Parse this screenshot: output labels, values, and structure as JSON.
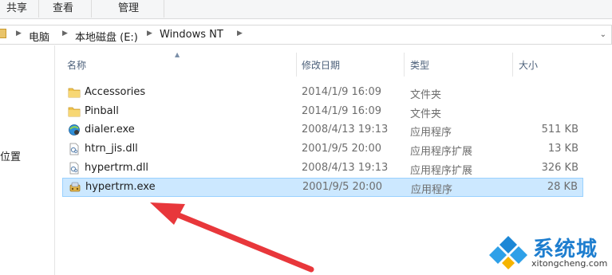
{
  "ribbon": {
    "tabs": [
      {
        "label": "共享"
      },
      {
        "label": "查看"
      },
      {
        "label": "管理"
      }
    ]
  },
  "address": {
    "crumbs": [
      "电脑",
      "本地磁盘 (E:)",
      "Windows NT"
    ]
  },
  "nav": {
    "partial_item": "位置"
  },
  "columns": {
    "name": "名称",
    "date": "修改日期",
    "type": "类型",
    "size": "大小"
  },
  "files": [
    {
      "name": "Accessories",
      "date": "2014/1/9 16:09",
      "type": "文件夹",
      "size": "",
      "icon": "folder-icon"
    },
    {
      "name": "Pinball",
      "date": "2014/1/9 16:09",
      "type": "文件夹",
      "size": "",
      "icon": "folder-icon"
    },
    {
      "name": "dialer.exe",
      "date": "2008/4/13 19:13",
      "type": "应用程序",
      "size": "511 KB",
      "icon": "dialer-app-icon"
    },
    {
      "name": "htrn_jis.dll",
      "date": "2001/9/5 20:00",
      "type": "应用程序扩展",
      "size": "13 KB",
      "icon": "dll-file-icon"
    },
    {
      "name": "hypertrm.dll",
      "date": "2008/4/13 19:13",
      "type": "应用程序扩展",
      "size": "326 KB",
      "icon": "dll-file-icon"
    },
    {
      "name": "hypertrm.exe",
      "date": "2001/9/5 20:00",
      "type": "应用程序",
      "size": "28 KB",
      "icon": "hyperterminal-app-icon",
      "selected": true
    }
  ],
  "watermark": {
    "brand": "系统城",
    "url": "xitongcheng.com"
  },
  "colors": {
    "selection_bg": "#cce8ff",
    "selection_border": "#99d1ff",
    "arrow": "#e8373b",
    "header_text": "#4c607a"
  }
}
